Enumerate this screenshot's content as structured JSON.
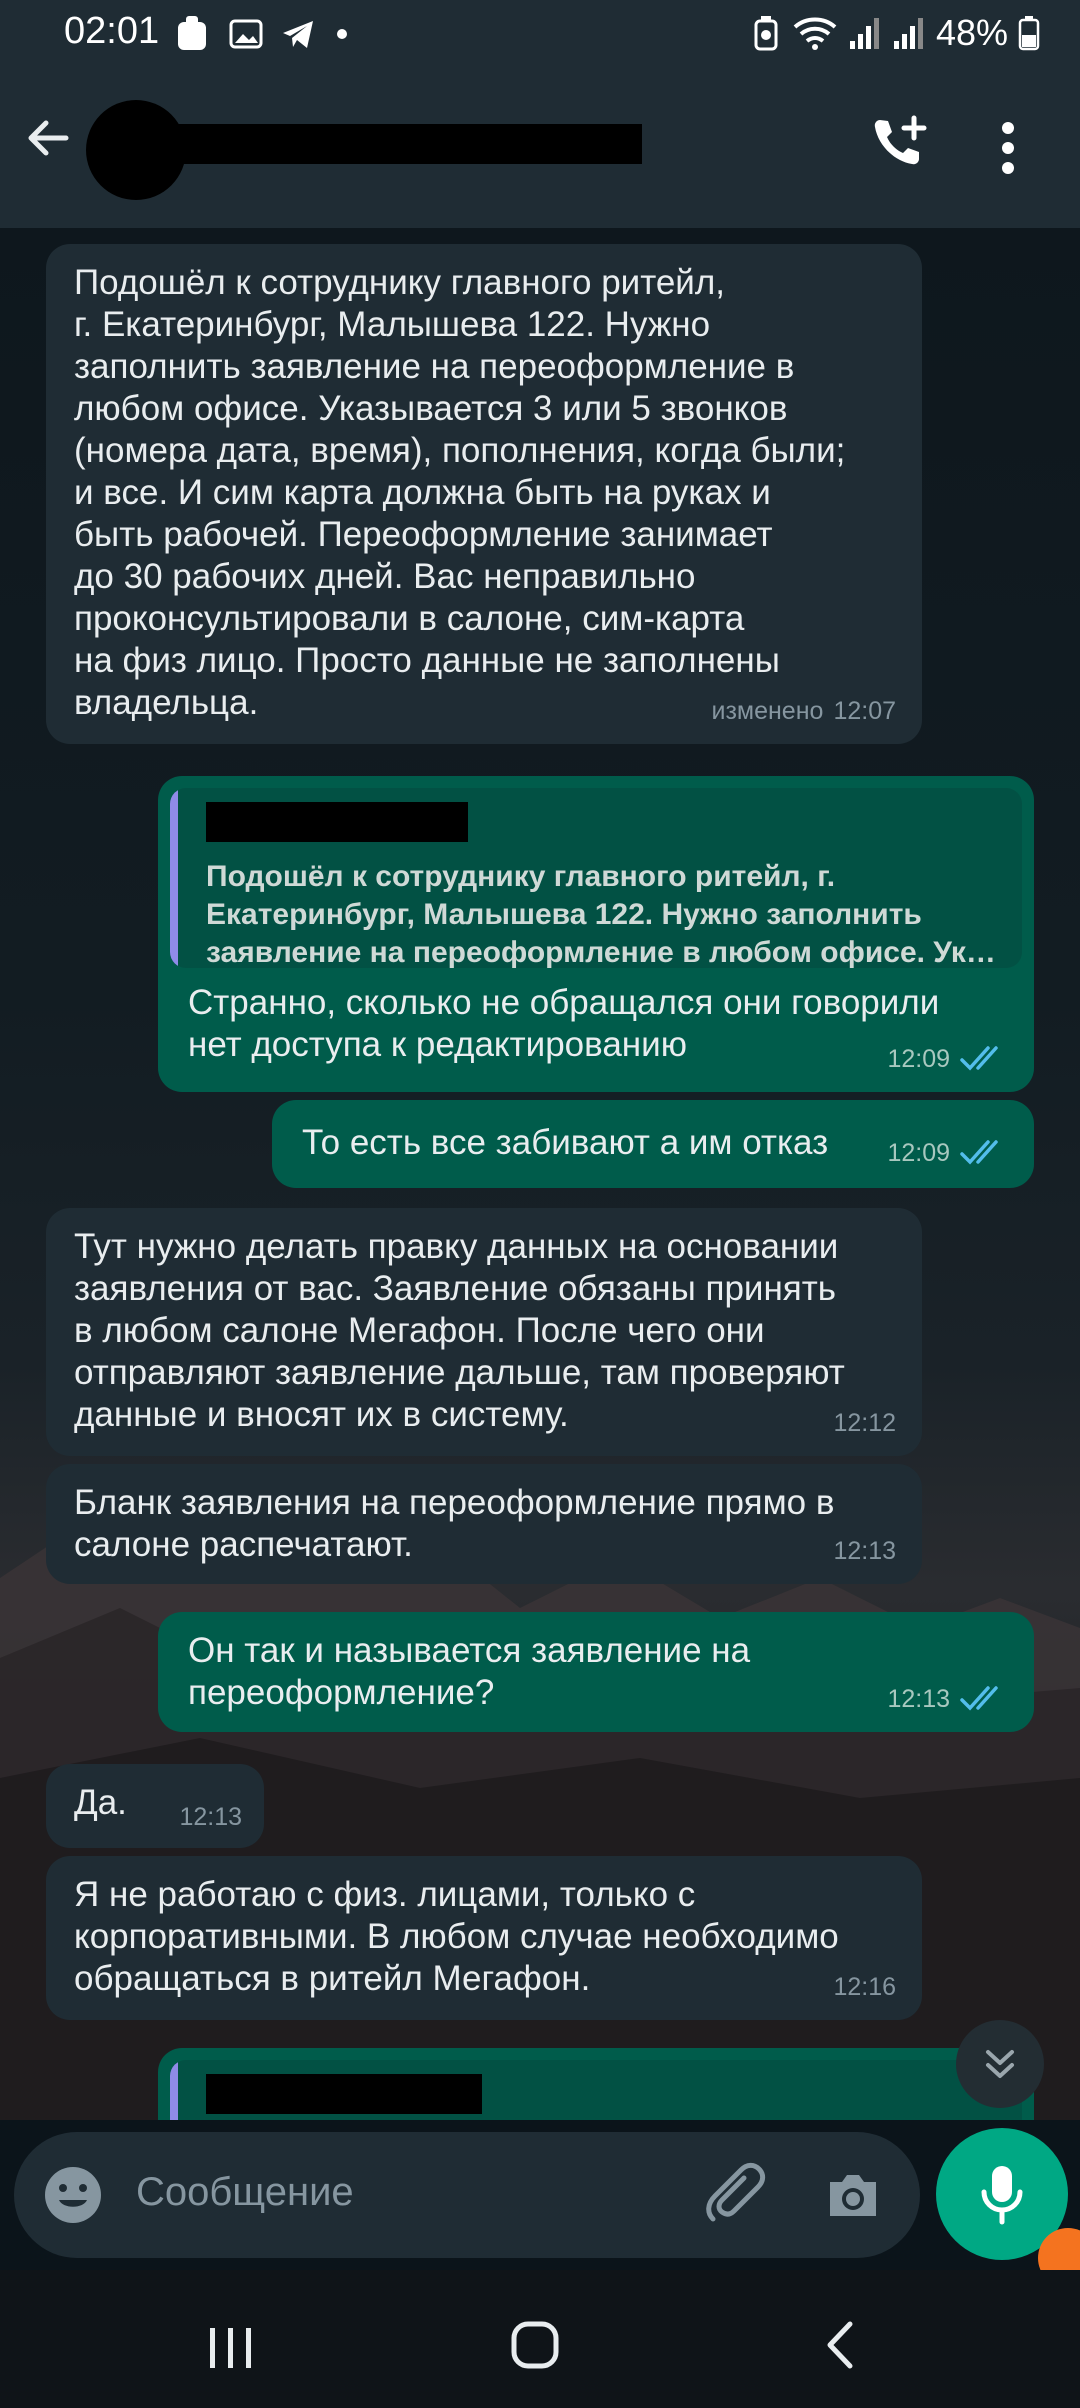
{
  "status_bar": {
    "time": "02:01",
    "battery": "48%"
  },
  "header": {
    "contact_name_redacted": true
  },
  "messages": [
    {
      "id": "m1",
      "direction": "in",
      "text": "Подошёл к сотруднику главного ритейл,\nг. Екатеринбург, Малышева 122. Нужно\nзаполнить заявление на переоформление в\nлюбом офисе. Указывается 3 или 5 звонков\n(номера дата, время), пополнения, когда были;\nи все. И сим карта должна быть на руках и\nбыть рабочей. Переоформление занимает\nдо 30 рабочих дней. Вас неправильно\nпроконсультировали в салоне, сим-карта\nна физ лицо. Просто данные не заполнены\nвладельца.",
      "edited_label": "изменено",
      "time": "12:07"
    },
    {
      "id": "m2",
      "direction": "out",
      "quote": "Подошёл к сотруднику главного ритейл, г. Екатеринбург, Малышева 122. Нужно заполнить заявление на переоформление в любом офисе. Ук…",
      "text": "Странно, сколько не обращался они говорили\nнет доступа к редактированию",
      "time": "12:09",
      "read": true
    },
    {
      "id": "m3",
      "direction": "out",
      "text": "То есть все забивают а им отказ",
      "time": "12:09",
      "read": true
    },
    {
      "id": "m4",
      "direction": "in",
      "text": "Тут нужно делать правку данных на основании\nзаявления от вас. Заявление обязаны принять\nв любом салоне Мегафон. После чего они\nотправляют заявление дальше, там проверяют\nданные и вносят их в систему.",
      "time": "12:12"
    },
    {
      "id": "m5",
      "direction": "in",
      "text": "Бланк заявления на переоформление прямо в\nсалоне распечатают.",
      "time": "12:13"
    },
    {
      "id": "m6",
      "direction": "out",
      "text": "Он так и называется заявление на\nпереоформление?",
      "time": "12:13",
      "read": true
    },
    {
      "id": "m7",
      "direction": "in",
      "text": "Да.",
      "time": "12:13"
    },
    {
      "id": "m8",
      "direction": "in",
      "text": "Я не работаю с физ. лицами, только с\nкорпоративными. В любом случае необходимо\nобращаться в ритейл Мегафон.",
      "time": "12:16"
    }
  ],
  "composer": {
    "placeholder": "Сообщение"
  },
  "colors": {
    "incoming_bubble": "#1f2c34",
    "outgoing_bubble": "#005c4b",
    "accent": "#00a884",
    "read_tick": "#53bdeb"
  },
  "icons": [
    "back-arrow-icon",
    "add-call-icon",
    "more-vert-icon",
    "emoji-icon",
    "attach-icon",
    "camera-icon",
    "mic-icon",
    "double-chevron-down-icon"
  ]
}
